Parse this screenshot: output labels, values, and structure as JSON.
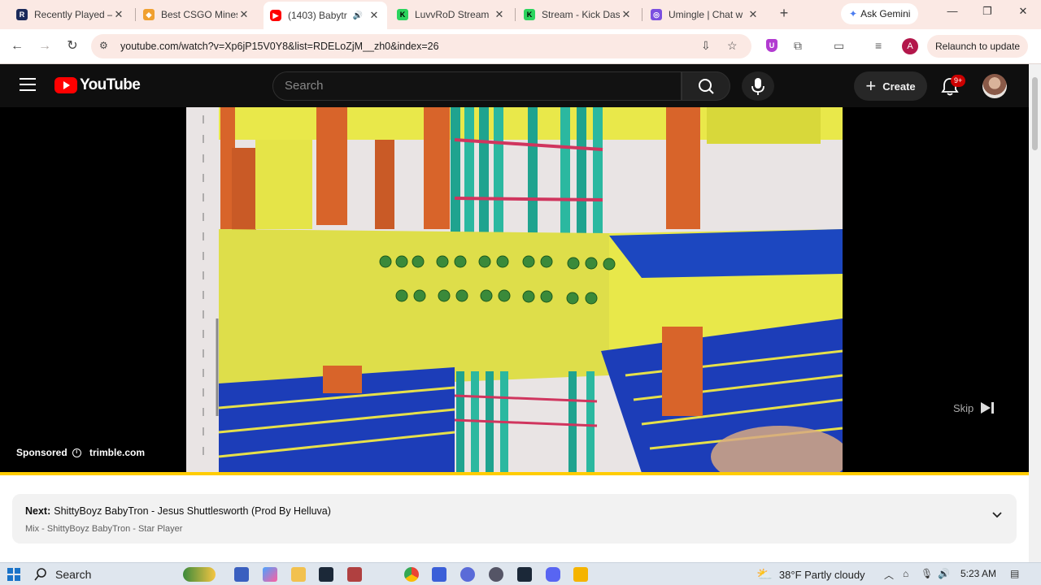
{
  "browser": {
    "tabs": [
      {
        "title": "Recently Played –",
        "icon": "r-icon",
        "color": "#1a2a5a",
        "glyph": "R"
      },
      {
        "title": "Best CSGO Mines",
        "icon": "diamond-icon",
        "color": "#f0a030",
        "glyph": "◆"
      },
      {
        "title": "(1403) Babytr",
        "icon": "youtube-icon",
        "color": "#ff0000",
        "glyph": "▶",
        "active": true
      },
      {
        "title": "LuvvRoD Stream",
        "icon": "kick-icon",
        "color": "#2bd45e",
        "glyph": "K"
      },
      {
        "title": "Stream - Kick Das",
        "icon": "kick-icon",
        "color": "#2bd45e",
        "glyph": "K"
      },
      {
        "title": "Umingle | Chat w",
        "icon": "umingle-icon",
        "color": "#7b4fe0",
        "glyph": "◎"
      }
    ],
    "gemini_label": "Ask Gemini",
    "url": "youtube.com/watch?v=Xp6jP15V0Y8&list=RDELoZjM__zh0&index=26",
    "profile_letter": "A",
    "relaunch_label": "Relaunch to update"
  },
  "youtube": {
    "logo_text": "YouTube",
    "search_placeholder": "Search",
    "create_label": "Create",
    "notification_badge": "9+"
  },
  "player": {
    "sponsored_label": "Sponsored",
    "advertiser": "trimble.com",
    "skip_label": "Skip",
    "progress_fraction": 1.0,
    "progress_color": "#ffcc00"
  },
  "up_next": {
    "prefix": "Next:",
    "title": "ShittyBoyz BabyTron - Jesus Shuttlesworth (Prod By Helluva)",
    "subtitle": "Mix - ShittyBoyz BabyTron - Star Player"
  },
  "taskbar": {
    "search_label": "Search",
    "weather": "38°F  Partly cloudy",
    "time": "5:23 AM"
  }
}
